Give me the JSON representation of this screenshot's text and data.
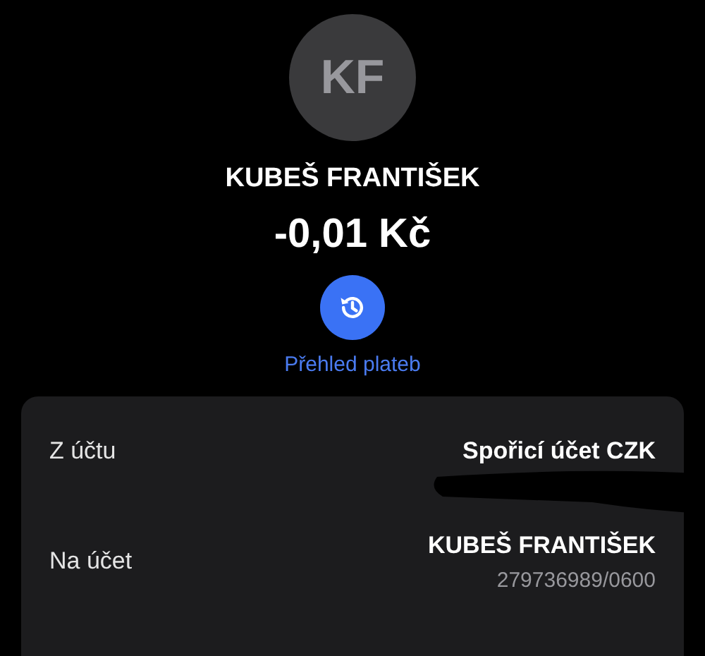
{
  "contact": {
    "initials": "KF",
    "name": "KUBEŠ FRANTIŠEK",
    "amount": "-0,01 Kč"
  },
  "history_button": {
    "label": "Přehled plateb"
  },
  "details": [
    {
      "label": "Z účtu",
      "value": "Spořicí účet CZK",
      "redacted": true
    },
    {
      "label": "Na účet",
      "value": "KUBEŠ FRANTIŠEK",
      "sub": "279736989/0600",
      "redacted": false
    }
  ]
}
